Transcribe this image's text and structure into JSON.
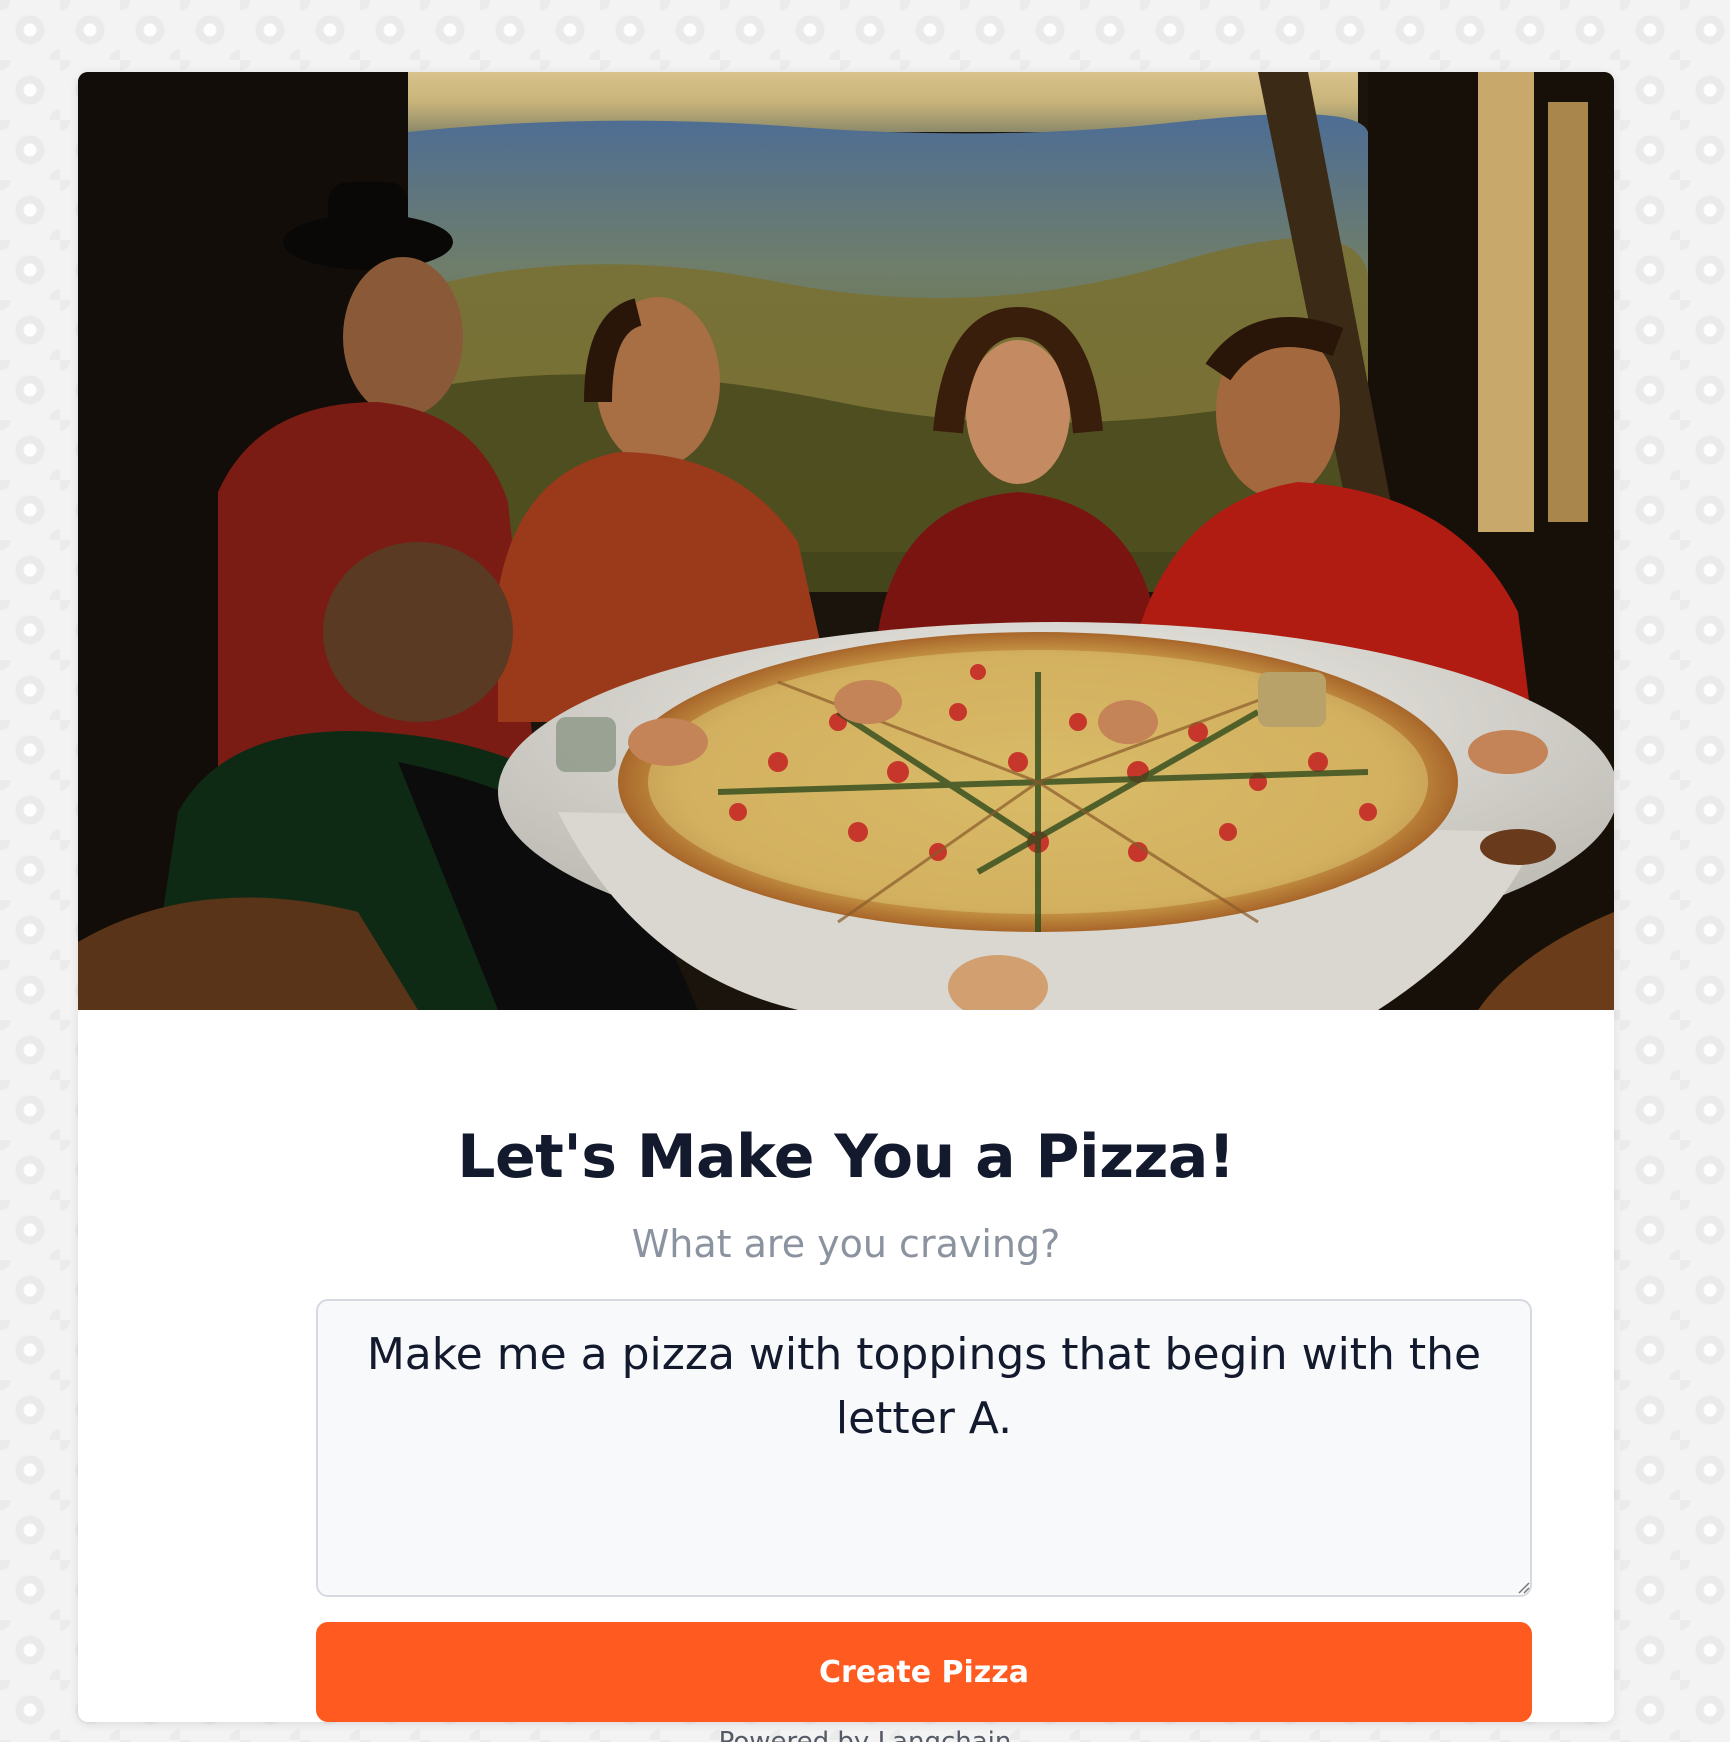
{
  "hero": {
    "image_alt": "Renaissance-style painting of five people around a table sharing a large pizza"
  },
  "main": {
    "title": "Let's Make You a Pizza!",
    "subtitle": "What are you craving?",
    "prompt_value": "Make me a pizza with toppings that begin with the letter A.",
    "create_button_label": "Create Pizza"
  },
  "footer": {
    "credit": "Powered by Langchain"
  },
  "colors": {
    "accent": "#ff5a1f",
    "title_text": "#131a2e",
    "subtitle_text": "#8c93a0",
    "input_border": "#d6dae0",
    "input_bg": "#f8f9fb"
  }
}
